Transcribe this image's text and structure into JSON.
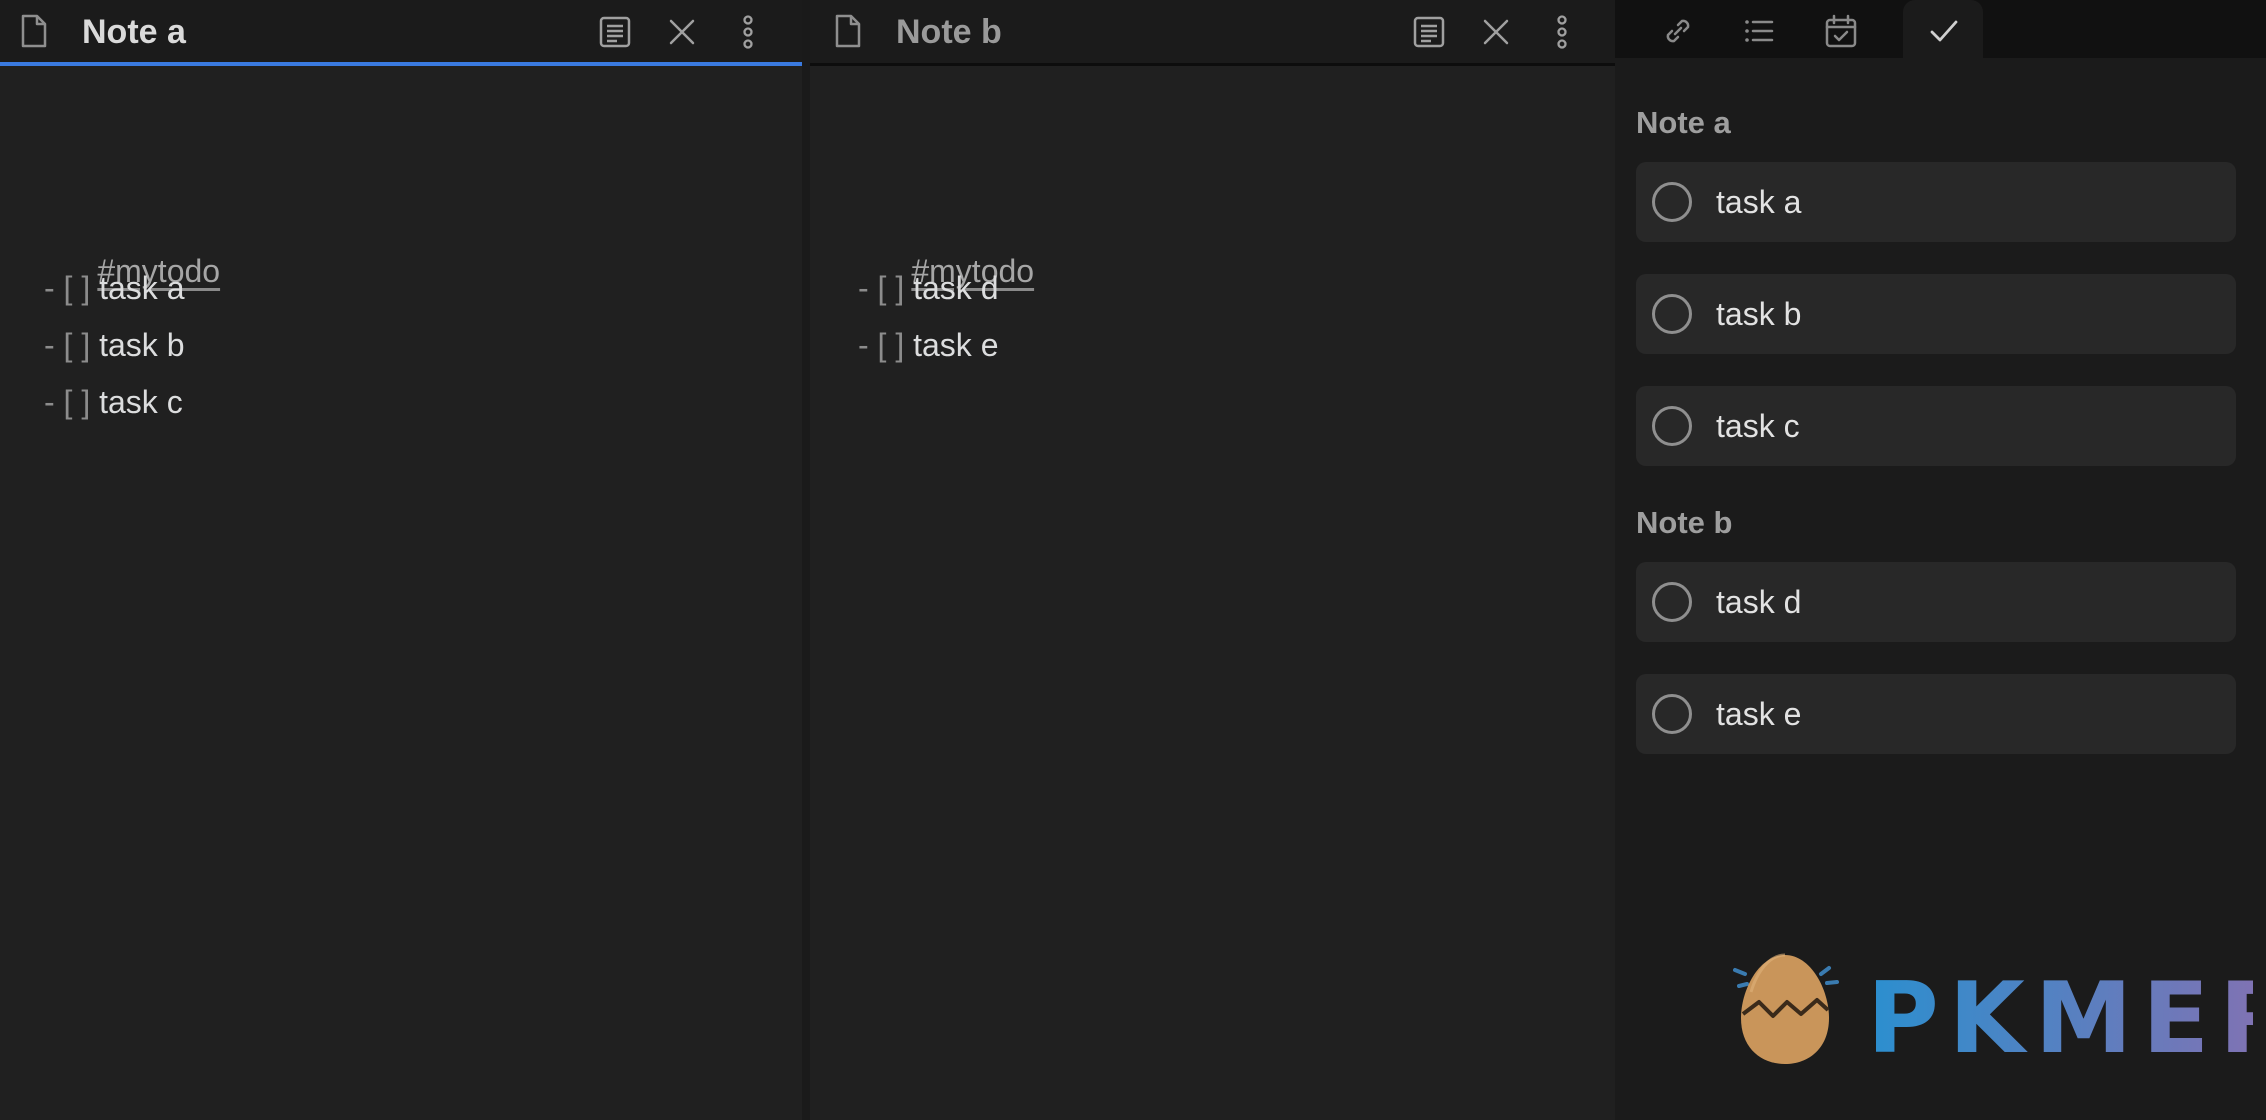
{
  "pane_a": {
    "title": "Note a",
    "content": {
      "tag": "#mytodo",
      "tasks": [
        {
          "prefix": "- ",
          "bracket": "[ ]",
          "text": " task a"
        },
        {
          "prefix": "- ",
          "bracket": "[ ]",
          "text": " task b"
        },
        {
          "prefix": "- ",
          "bracket": "[ ]",
          "text": " task c"
        }
      ]
    }
  },
  "pane_b": {
    "title": "Note b",
    "content": {
      "tag": "#mytodo",
      "tasks": [
        {
          "prefix": "- ",
          "bracket": "[ ]",
          "text": " task d"
        },
        {
          "prefix": "- ",
          "bracket": "[ ]",
          "text": " task e"
        }
      ]
    }
  },
  "header_icons": [
    "reading-view-icon",
    "close-icon",
    "more-options-icon"
  ],
  "sidebar": {
    "tabs": [
      {
        "icon": "link-icon",
        "active": false
      },
      {
        "icon": "list-icon",
        "active": false
      },
      {
        "icon": "calendar-check-icon",
        "active": false
      },
      {
        "icon": "check-icon",
        "active": true
      }
    ],
    "groups": [
      {
        "title": "Note a",
        "tasks": [
          "task a",
          "task b",
          "task c"
        ]
      },
      {
        "title": "Note b",
        "tasks": [
          "task d",
          "task e"
        ]
      }
    ]
  },
  "logo": {
    "text": "PKMER"
  },
  "colors": {
    "accent": "#3a7ae0",
    "background": "#202020",
    "sidebar": "#1b1b1b",
    "card": "#282828",
    "logo_start": "#2b8fcf",
    "logo_end": "#8a6fb0",
    "egg": "#c9955a"
  }
}
